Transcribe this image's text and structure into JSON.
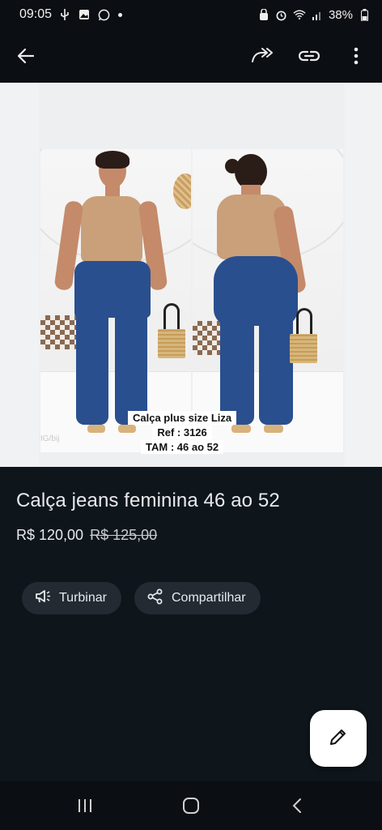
{
  "status": {
    "time": "09:05",
    "battery": "38%"
  },
  "app_bar": {
    "back_icon": "arrow-left-icon",
    "forward_icon": "share-forward-icon",
    "link_icon": "link-icon",
    "menu_icon": "more-vert-icon"
  },
  "image": {
    "caption_line1": "Calça plus size Liza",
    "caption_line2": "Ref : 3126",
    "caption_line3": "TAM : 46 ao 52",
    "watermark": "IG/bij"
  },
  "product": {
    "title": "Calça jeans feminina 46 ao 52",
    "price": "R$ 120,00",
    "old_price": "R$ 125,00"
  },
  "actions": {
    "boost_label": "Turbinar",
    "share_label": "Compartilhar"
  },
  "colors": {
    "background": "#0e151b",
    "chip": "#232a31",
    "fab": "#ffffff"
  }
}
